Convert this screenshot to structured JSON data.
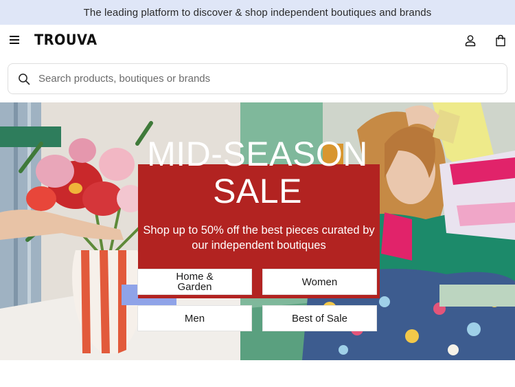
{
  "announcement": {
    "text": "The leading platform to discover & shop independent boutiques and brands"
  },
  "header": {
    "logo": "TROUVA",
    "menu_icon": "hamburger-menu-icon",
    "account_icon": "user-icon",
    "bag_icon": "shopping-bag-icon"
  },
  "search": {
    "placeholder": "Search products, boutiques or brands",
    "icon": "search-icon"
  },
  "hero": {
    "title_line1": "MID-SEASON",
    "title_line2": "SALE",
    "subtitle": "Shop up to 50% off the best pieces curated by our independent boutiques",
    "buttons": [
      {
        "label": "Home & Garden"
      },
      {
        "label": "Women"
      },
      {
        "label": "Men"
      },
      {
        "label": "Best of Sale"
      }
    ]
  },
  "colors": {
    "announcement_bg": "#dfe6f7",
    "sale_red": "#b22321",
    "teal_accent": "#2e7d5c",
    "periwinkle_accent": "#8fa3e8",
    "sage_accent": "#bcd5c0"
  }
}
